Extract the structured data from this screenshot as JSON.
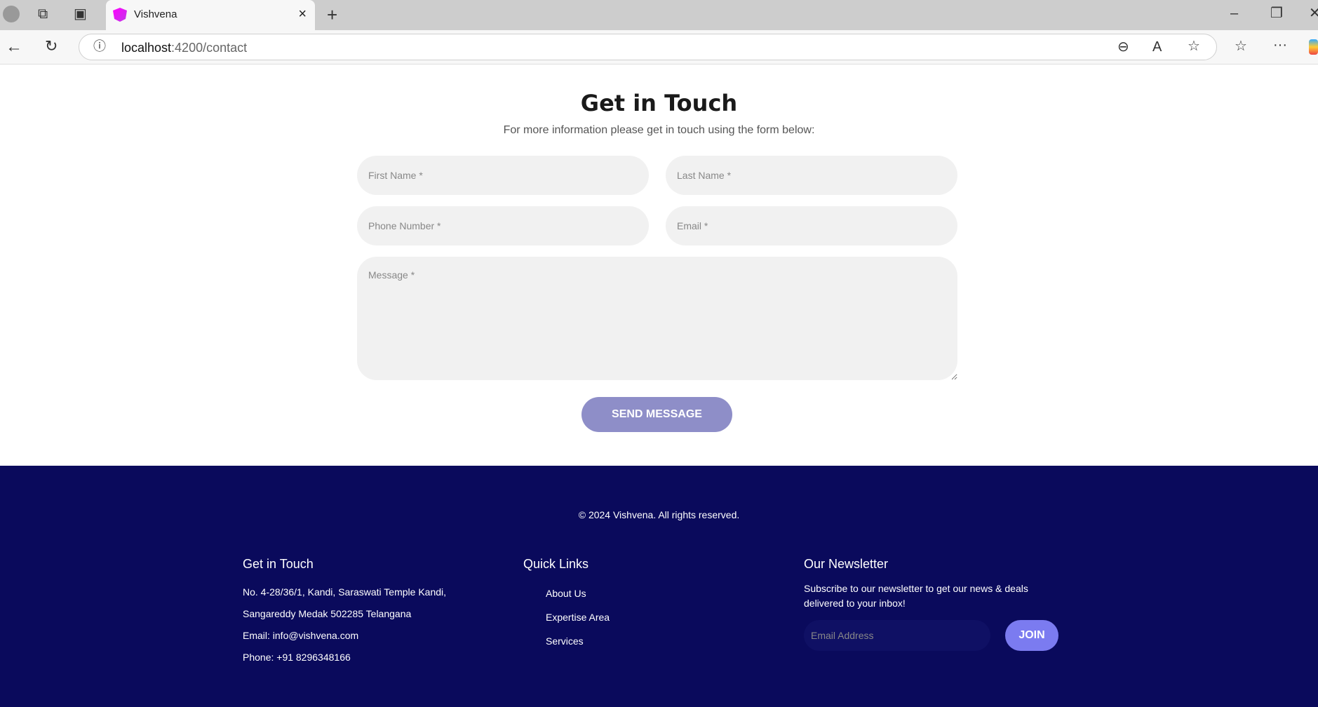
{
  "browser": {
    "tab_title": "Vishvena",
    "url_host": "localhost",
    "url_path": ":4200/contact"
  },
  "contact": {
    "title": "Get in Touch",
    "subtitle": "For more information please get in touch using the form below:",
    "first_name": "First Name *",
    "last_name": "Last Name *",
    "phone": "Phone Number *",
    "email": "Email *",
    "message": "Message *",
    "send": "SEND MESSAGE"
  },
  "footer": {
    "copyright": "© 2024 Vishvena. All rights reserved.",
    "touch": {
      "heading": "Get in Touch",
      "address1": "No. 4-28/36/1, Kandi, Saraswati Temple Kandi,",
      "address2": "Sangareddy Medak 502285 Telangana",
      "email": "Email: info@vishvena.com",
      "phone": "Phone: +91 8296348166"
    },
    "links": {
      "heading": "Quick Links",
      "items": [
        "About Us",
        "Expertise Area",
        "Services"
      ]
    },
    "newsletter": {
      "heading": "Our Newsletter",
      "text": "Subscribe to our newsletter to get our news & deals delivered to your inbox!",
      "placeholder": "Email Address",
      "join": "JOIN"
    }
  }
}
